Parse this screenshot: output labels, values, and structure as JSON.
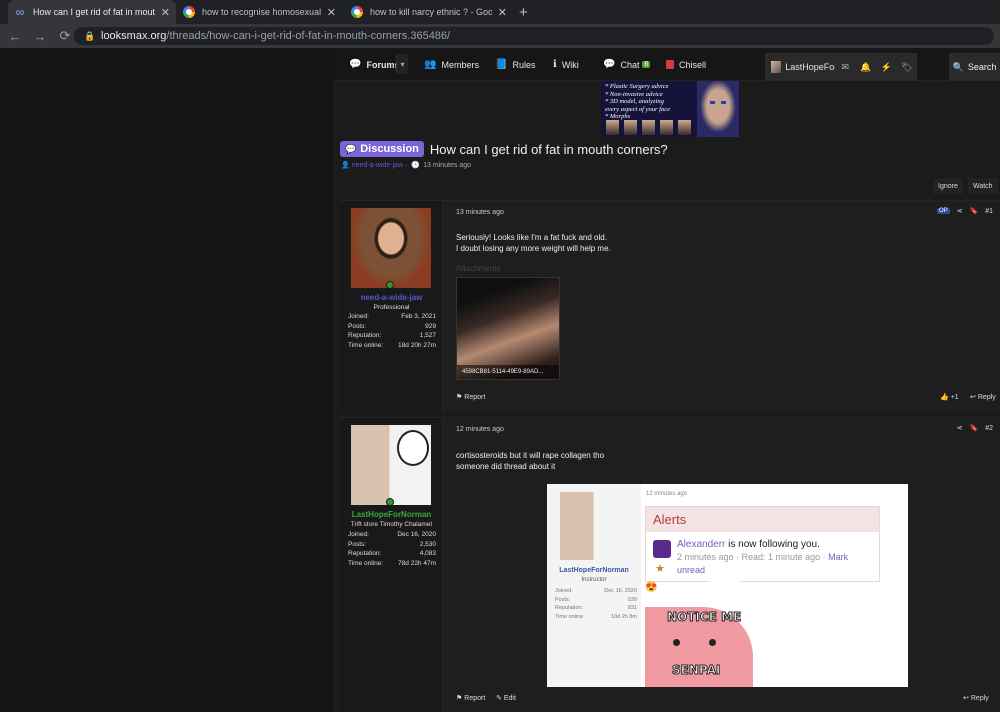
{
  "browser": {
    "tabs": [
      {
        "title": "How can I get rid of fat in mouth",
        "active": true,
        "favicon": "infinity-icon"
      },
      {
        "title": "how to recognise homosexuality",
        "active": false,
        "favicon": "google-icon"
      },
      {
        "title": "how to kill narcy ethnic ? - Goog",
        "active": false,
        "favicon": "google-icon"
      }
    ],
    "new_tab": "+",
    "url_host": "looksmax.org",
    "url_path": "/threads/how-can-i-get-rid-of-fat-in-mouth-corners.365486/"
  },
  "nav": {
    "forums": "Forums",
    "members": "Members",
    "rules": "Rules",
    "wiki": "Wiki",
    "chat": "Chat",
    "chat_badge": "6",
    "chisell": "Chisell",
    "user": "LastHopeFor...",
    "search": "Search"
  },
  "banner": {
    "lines": [
      "* Plastic Surgery advice",
      "* Non-invasive advice",
      "* 3D model, analyzing",
      "  every aspect of your face",
      "* Morphs"
    ]
  },
  "thread": {
    "prefix": "Discussion",
    "title": "How can I get rid of fat in mouth corners?",
    "author": "need-a-wide-jaw",
    "sep": "·",
    "time": "13 minutes ago",
    "ignore": "Ignore",
    "watch": "Watch"
  },
  "posts": [
    {
      "date": "13 minutes ago",
      "op_badge": "OP",
      "number": "#1",
      "lines": [
        "Seriously! Looks like I'm a fat fuck and old.",
        "I doubt losing any more weight will help me."
      ],
      "attachments_label": "Attachments",
      "attachment_caption": "4598CB81-5114-49E9-89AD...",
      "report": "Report",
      "reaction": "+1",
      "reply": "Reply",
      "user": {
        "name": "need-a-wide-jaw",
        "name_color": "#5555d0",
        "title": "Professional",
        "stats": [
          {
            "k": "Joined:",
            "v": "Feb 3, 2021"
          },
          {
            "k": "Posts:",
            "v": "929"
          },
          {
            "k": "Reputation:",
            "v": "1,527"
          },
          {
            "k": "Time online:",
            "v": "18d 20h 27m"
          }
        ]
      }
    },
    {
      "date": "12 minutes ago",
      "number": "#2",
      "lines": [
        "cortisosteroids but it will rape collagen tho",
        "someone did thread about it"
      ],
      "report": "Report",
      "edit": "Edit",
      "reply": "Reply",
      "user": {
        "name": "LastHopeForNorman",
        "name_color": "#3aa83a",
        "title": "Trift store Timothy Chalamet",
        "stats": [
          {
            "k": "Joined:",
            "v": "Dec 16, 2020"
          },
          {
            "k": "Posts:",
            "v": "2,530"
          },
          {
            "k": "Reputation:",
            "v": "4,083"
          },
          {
            "k": "Time online:",
            "v": "78d 22h 47m"
          }
        ]
      },
      "embed": {
        "date": "12 minutes ago",
        "name": "LastHopeForNorman",
        "role": "Instructor",
        "stats": [
          {
            "k": "Joined:",
            "v": "Dec 16, 2020"
          },
          {
            "k": "Posts:",
            "v": "539"
          },
          {
            "k": "Reputation:",
            "v": "831"
          },
          {
            "k": "Time online:",
            "v": "10d 2h 8m"
          }
        ],
        "alerts_title": "Alerts",
        "alert_user": "Alexanderr",
        "alert_text": " is now following you.",
        "alert_meta": "2 minutes ago · Read: 1 minute ago · ",
        "alert_mark": "Mark",
        "alert_unread": "unread",
        "meme_top": "NOTICE ME",
        "meme_bottom": "SENPAI"
      }
    }
  ]
}
